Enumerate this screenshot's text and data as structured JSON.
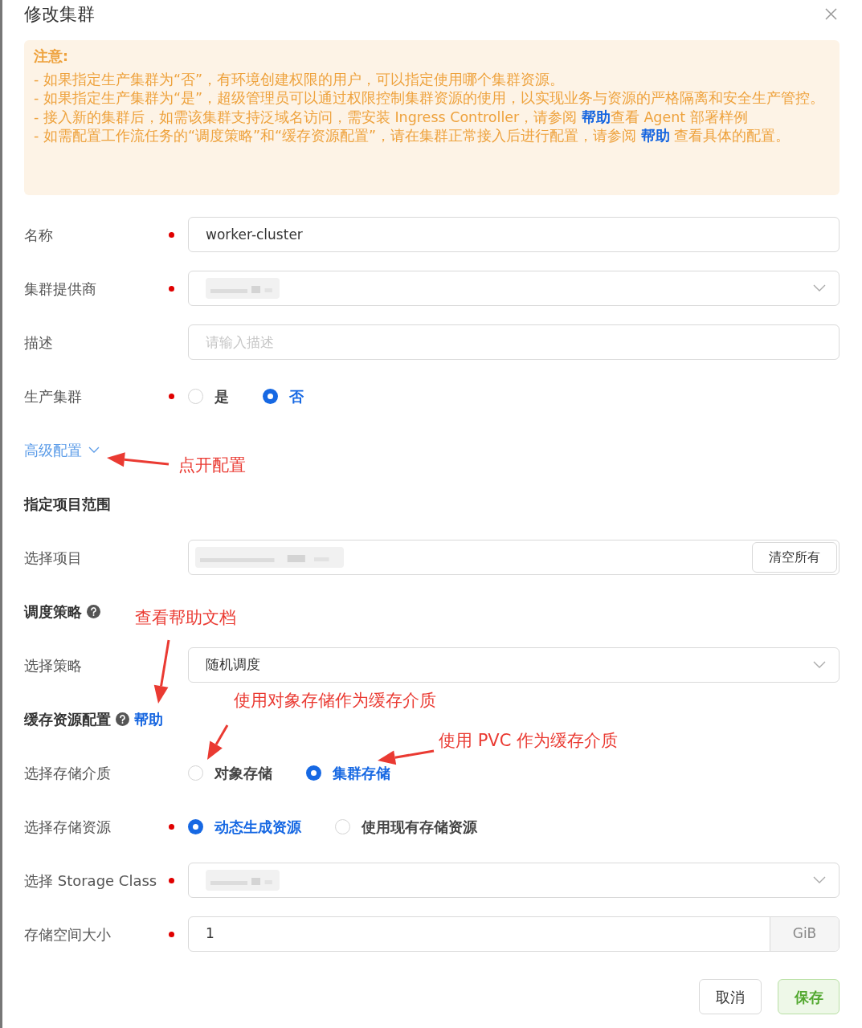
{
  "dialog": {
    "title": "修改集群"
  },
  "notice": {
    "heading": "注意:",
    "lines": [
      {
        "parts": [
          {
            "kind": "text",
            "text": "- 如果指定生产集群为“否”，有环境创建权限的用户，可以指定使用哪个集群资源。"
          }
        ]
      },
      {
        "parts": [
          {
            "kind": "text",
            "text": "- 如果指定生产集群为“是”，超级管理员可以通过权限控制集群资源的使用，以实现业务与资源的严格隔离和安全生产管控。"
          }
        ]
      },
      {
        "parts": [
          {
            "kind": "text",
            "text": "- 接入新的集群后，如需该集群支持泛域名访问，需安装 Ingress Controller，请参阅 "
          },
          {
            "kind": "link",
            "text": "帮助"
          },
          {
            "kind": "text",
            "text": "查看 Agent 部署样例"
          }
        ]
      },
      {
        "parts": [
          {
            "kind": "text",
            "text": "- 如需配置工作流任务的“调度策略”和“缓存资源配置”，请在集群正常接入后进行配置，请参阅 "
          },
          {
            "kind": "link",
            "text": "帮助"
          },
          {
            "kind": "text",
            "text": " 查看具体的配置。"
          }
        ]
      }
    ]
  },
  "fields": [
    {
      "kind": "input",
      "label": "名称",
      "required": true,
      "value": "worker-cluster"
    },
    {
      "kind": "select",
      "label": "集群提供商",
      "required": true,
      "redacted": true
    },
    {
      "kind": "input",
      "label": "描述",
      "required": false,
      "placeholder": "请输入描述"
    },
    {
      "kind": "radio",
      "label": "生产集群",
      "required": true,
      "options": [
        {
          "label": "是",
          "selected": false
        },
        {
          "label": "否",
          "selected": true
        }
      ]
    }
  ],
  "advanced": {
    "label": "高级配置",
    "expanded": true
  },
  "sections": [
    {
      "title": "指定项目范围",
      "help_icon": false,
      "fields": [
        {
          "kind": "tags",
          "label": "选择项目",
          "required": false,
          "redacted": true,
          "button": "清空所有"
        }
      ]
    },
    {
      "title": "调度策略",
      "help_icon": true,
      "fields": [
        {
          "kind": "select",
          "label": "选择策略",
          "required": false,
          "value": "随机调度"
        }
      ]
    },
    {
      "title": "缓存资源配置",
      "help_icon": true,
      "link": "帮助",
      "fields": [
        {
          "kind": "radio",
          "label": "选择存储介质",
          "required": false,
          "options": [
            {
              "label": "对象存储",
              "selected": false
            },
            {
              "label": "集群存储",
              "selected": true
            }
          ]
        },
        {
          "kind": "radio",
          "label": "选择存储资源",
          "required": true,
          "options": [
            {
              "label": "动态生成资源",
              "selected": true
            },
            {
              "label": "使用现有存储资源",
              "selected": false
            }
          ]
        },
        {
          "kind": "select",
          "label": "选择 Storage Class",
          "required": true,
          "redacted": true
        },
        {
          "kind": "unit",
          "label": "存储空间大小",
          "required": true,
          "value": "1",
          "unit": "GiB"
        }
      ]
    }
  ],
  "footer": {
    "buttons": [
      {
        "label": "取消",
        "kind": "default"
      },
      {
        "label": "保存",
        "kind": "primary"
      }
    ]
  },
  "annotations": [
    {
      "text": "点开配置"
    },
    {
      "text": "查看帮助文档"
    },
    {
      "text": "使用对象存储作为缓存介质"
    },
    {
      "text": "使用 PVC 作为缓存介质"
    }
  ]
}
